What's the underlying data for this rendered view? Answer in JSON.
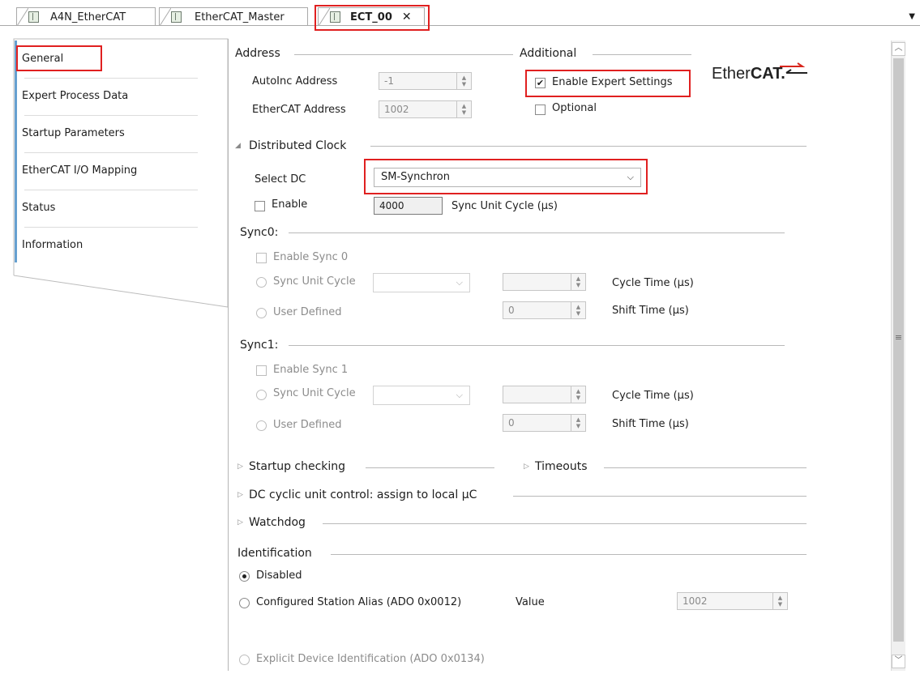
{
  "tabs": [
    {
      "label": "A4N_EtherCAT",
      "active": false
    },
    {
      "label": "EtherCAT_Master",
      "active": false
    },
    {
      "label": "ECT_00",
      "active": true,
      "close": "✕"
    }
  ],
  "sidebar": {
    "items": [
      {
        "label": "General",
        "selected": true
      },
      {
        "label": "Expert Process Data"
      },
      {
        "label": "Startup Parameters"
      },
      {
        "label": "EtherCAT I/O Mapping"
      },
      {
        "label": "Status"
      },
      {
        "label": "Information"
      }
    ]
  },
  "address": {
    "title": "Address",
    "autoinc_label": "AutoInc Address",
    "autoinc_value": "-1",
    "ethercat_label": "EtherCAT Address",
    "ethercat_value": "1002"
  },
  "additional": {
    "title": "Additional",
    "expert_label": "Enable Expert Settings",
    "expert_checked": "✔",
    "optional_label": "Optional",
    "logo_text": "Ether",
    "logo_bold": "CAT."
  },
  "dc": {
    "title": "Distributed Clock",
    "select_label": "Select DC",
    "select_value": "SM-Synchron",
    "enable_label": "Enable",
    "cycle_value": "4000",
    "cycle_label": "Sync Unit Cycle (µs)"
  },
  "sync0": {
    "title": "Sync0:",
    "enable_label": "Enable Sync 0",
    "unit_cycle_label": "Sync Unit Cycle",
    "user_defined_label": "User Defined",
    "cycle_time_label": "Cycle Time (µs)",
    "shift_time_label": "Shift Time (µs)",
    "shift_value": "0"
  },
  "sync1": {
    "title": "Sync1:",
    "enable_label": "Enable Sync 1",
    "unit_cycle_label": "Sync Unit Cycle",
    "user_defined_label": "User Defined",
    "cycle_time_label": "Cycle Time (µs)",
    "shift_time_label": "Shift Time (µs)",
    "shift_value": "0"
  },
  "collapsed": {
    "startup": "Startup checking",
    "timeouts": "Timeouts",
    "dc_cyclic": "DC cyclic unit control: assign to local µC",
    "watchdog": "Watchdog"
  },
  "identification": {
    "title": "Identification",
    "disabled_label": "Disabled",
    "alias_label": "Configured Station Alias (ADO 0x0012)",
    "value_label": "Value",
    "value": "1002",
    "explicit_label": "Explicit Device Identification (ADO 0x0134)"
  },
  "colors": {
    "highlight": "#e02020",
    "accent": "#66a0d0"
  }
}
